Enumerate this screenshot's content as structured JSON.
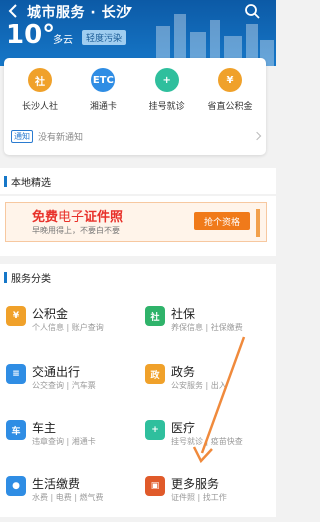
{
  "header": {
    "title": "城市服务 · 长沙",
    "temperature": "10°",
    "weather": "多云",
    "air_quality": "轻度污染"
  },
  "quick_links": [
    {
      "label": "长沙人社",
      "icon": "社",
      "color": "#f0a12a"
    },
    {
      "label": "湘通卡",
      "icon": "ETC",
      "color": "#2f8de4"
    },
    {
      "label": "挂号就诊",
      "icon": "+",
      "color": "#2fbf9d"
    },
    {
      "label": "省直公积金",
      "icon": "¥",
      "color": "#f0a12a"
    }
  ],
  "notice": {
    "tag": "通知",
    "text": "没有新通知"
  },
  "local": {
    "title": "本地精选"
  },
  "promo": {
    "free": "免费",
    "mid": "电子",
    "cert": "证件照",
    "sub": "早晚用得上，不要白不要",
    "button": "抢个资格"
  },
  "service_section": {
    "title": "服务分类"
  },
  "services": [
    {
      "name": "公积金",
      "desc": "个人信息 | 账户查询",
      "icon": "¥",
      "color": "#f0a12a"
    },
    {
      "name": "社保",
      "desc": "养保信息 | 社保缴费",
      "icon": "社",
      "color": "#2fb36a"
    },
    {
      "name": "交通出行",
      "desc": "公交查询 | 汽车票",
      "icon": "≡",
      "color": "#2f8de4"
    },
    {
      "name": "政务",
      "desc": "公安服务 | 出入",
      "icon": "政",
      "color": "#f0a12a"
    },
    {
      "name": "车主",
      "desc": "违章查询 | 湘通卡",
      "icon": "车",
      "color": "#2f8de4"
    },
    {
      "name": "医疗",
      "desc": "挂号就诊 | 疫苗快查",
      "icon": "+",
      "color": "#2fbf9d"
    },
    {
      "name": "生活缴费",
      "desc": "水费 | 电费 | 燃气费",
      "icon": "●",
      "color": "#2f8de4"
    },
    {
      "name": "更多服务",
      "desc": "证件照 | 找工作",
      "icon": "▣",
      "color": "#e05a2a"
    }
  ]
}
